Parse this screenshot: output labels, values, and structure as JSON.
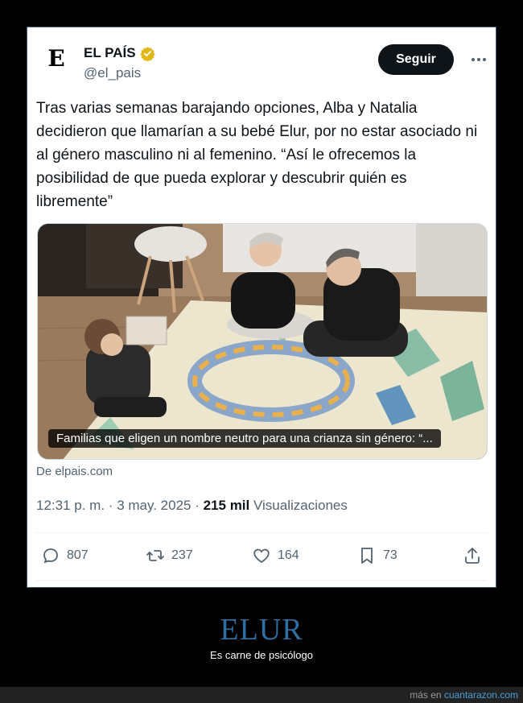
{
  "tweet": {
    "account": {
      "avatar_letter": "E",
      "name": "EL PAÍS",
      "handle": "@el_pais",
      "verified_color": "#e2b719"
    },
    "follow_label": "Seguir",
    "text": "Tras varias semanas barajando opciones, Alba y Natalia decidieron que llamarían a su bebé Elur, por no estar asociado ni al género masculino ni al femenino. “Así le ofrecemos la posibilidad de que pueda explorar y descubrir quién es libremente”",
    "card": {
      "caption": "Familias que eligen un nombre neutro para una crianza sin género: “...",
      "source": "De elpais.com"
    },
    "meta": {
      "time": "12:31 p. m.",
      "date": "3 may. 2025",
      "views_count": "215 mil",
      "views_label": "Visualizaciones"
    },
    "actions": {
      "replies": "807",
      "retweets": "237",
      "likes": "164",
      "bookmarks": "73"
    }
  },
  "post": {
    "title": "ELUR",
    "subtitle": "Es carne de psicólogo"
  },
  "footer": {
    "prefix": "más en",
    "site": "cuantarazon.com",
    "title_color": "#2e6fa4"
  }
}
